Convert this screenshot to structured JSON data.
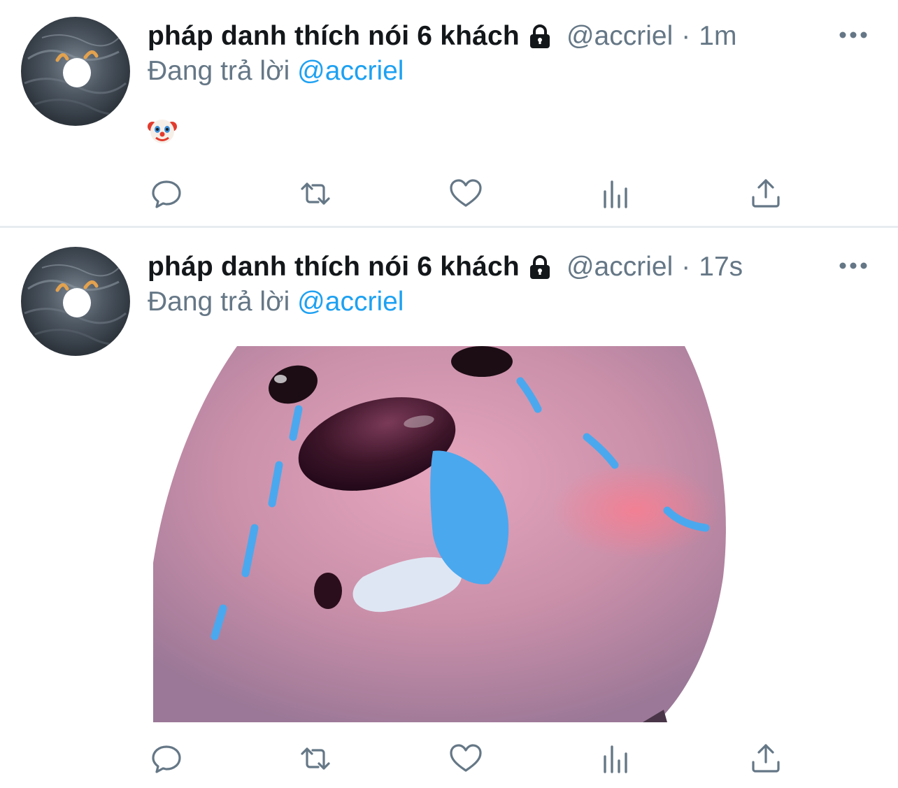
{
  "tweets": [
    {
      "display_name": "pháp danh thích nói 6 khách",
      "handle": "@accriel",
      "separator": "·",
      "time": "1m",
      "reply_prefix": "Đang trả lời",
      "reply_to": "@accriel",
      "content_icon": "clown-face-emoji"
    },
    {
      "display_name": "pháp danh thích nói 6 khách",
      "handle": "@accriel",
      "separator": "·",
      "time": "17s",
      "reply_prefix": "Đang trả lời",
      "reply_to": "@accriel",
      "content_icon": "crying-pink-blob-image"
    }
  ],
  "action_icons": [
    "reply-icon",
    "retweet-icon",
    "like-icon",
    "analytics-icon",
    "share-icon"
  ],
  "colors": {
    "text": "#14171a",
    "secondary": "#657786",
    "link": "#1da1f2",
    "divider": "#e6ecf0",
    "media_blob": "#c98fa9",
    "tear": "#4aa8ef"
  }
}
